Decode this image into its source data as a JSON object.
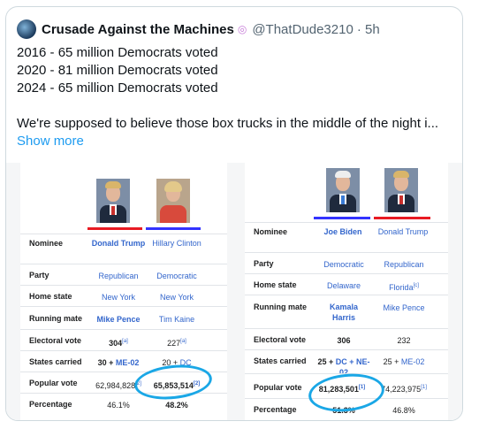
{
  "tweet": {
    "display_name": "Crusade Against the Machines",
    "badge": "◎",
    "handle": "@ThatDude3210",
    "time": "· 5h",
    "lines": [
      "2016 - 65 million Democrats voted",
      "2020 - 81 million Democrats voted",
      "2024 - 65 million Democrats voted",
      "",
      "We're supposed to believe those box trucks in the middle of the night i..."
    ],
    "show_more": "Show more"
  },
  "panel_2016": {
    "nominee_label": "Nominee",
    "nominee_1": "Donald Trump",
    "nominee_2": "Hillary Clinton",
    "party_label": "Party",
    "party_1": "Republican",
    "party_2": "Democratic",
    "home_label": "Home state",
    "home_1": "New York",
    "home_2": "New York",
    "running_label": "Running mate",
    "running_1": "Mike Pence",
    "running_2": "Tim Kaine",
    "electoral_label": "Electoral vote",
    "electoral_1": "304",
    "electoral_1_ref": "[a]",
    "electoral_2": "227",
    "electoral_2_ref": "[a]",
    "states_label": "States carried",
    "states_1": "30 + ",
    "states_1_link": "ME-02",
    "states_2": "20 + ",
    "states_2_link": "DC",
    "popular_label": "Popular vote",
    "popular_1": "62,984,828",
    "popular_1_ref": "[2]",
    "popular_2": "65,853,514",
    "popular_2_ref": "[2]",
    "percent_label": "Percentage",
    "percent_1": "46.1%",
    "percent_2": "48.2%"
  },
  "panel_2020": {
    "nominee_label": "Nominee",
    "nominee_1": "Joe Biden",
    "nominee_2": "Donald Trump",
    "party_label": "Party",
    "party_1": "Democratic",
    "party_2": "Republican",
    "home_label": "Home state",
    "home_1": "Delaware",
    "home_2": "Florida",
    "home_2_ref": "[c]",
    "running_label": "Running mate",
    "running_1": "Kamala Harris",
    "running_2": "Mike Pence",
    "electoral_label": "Electoral vote",
    "electoral_1": "306",
    "electoral_2": "232",
    "states_label": "States carried",
    "states_1": "25 + ",
    "states_1_link": "DC",
    "states_1_cont": " + NE-02",
    "states_2": "25 + ",
    "states_2_link": "ME-02",
    "popular_label": "Popular vote",
    "popular_1": "81,283,501",
    "popular_1_ref": "[1]",
    "popular_2": "74,223,975",
    "popular_2_ref": "[1]",
    "percent_label": "Percentage",
    "percent_1": "51.3%",
    "percent_2": "46.8%"
  },
  "colors": {
    "republican": "#e81b23",
    "democratic": "#3333ff",
    "link": "#3366cc",
    "highlight_circle": "#1aa7e6"
  }
}
